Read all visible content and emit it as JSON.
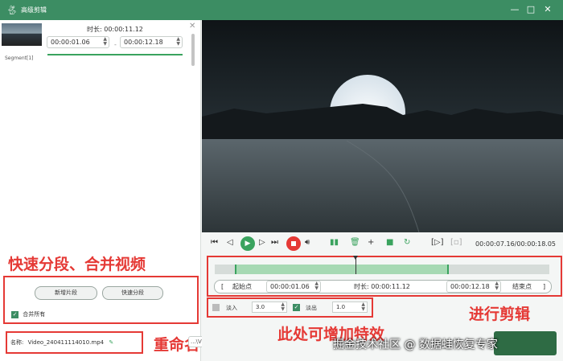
{
  "window": {
    "title": "高级剪辑",
    "logo_icon": "rabbit-logo-icon",
    "minimize": "—",
    "maximize": "□",
    "close": "✕"
  },
  "segment": {
    "label": "Segment[1]",
    "duration_label": "时长: 00:00:11.12",
    "start": "00:00:01.06",
    "end": "00:00:12.18",
    "dash": "-",
    "close": "✕",
    "progress": 1.0
  },
  "left_actions": {
    "new_segment": "新增片段",
    "quick_split": "快速分段",
    "merge_all": "合并所有",
    "merge_checked": true
  },
  "name_field": {
    "label": "名称:",
    "value": "Video_240411114010.mp4"
  },
  "output_field": {
    "value": "...\\Video"
  },
  "annotations": {
    "quick_split": "快速分段、合并视频",
    "rename": "重命名",
    "edit": "进行剪辑",
    "effects": "此处可增加特效"
  },
  "player": {
    "timecode": "00:00:07.16/00:00:18.05",
    "selection_start": 0.06,
    "selection_end": 0.7,
    "playhead": 0.42
  },
  "trim": {
    "start_btn": "起始点",
    "start_value": "00:00:01.06",
    "duration": "时长: 00:00:11.12",
    "end_value": "00:00:12.18",
    "end_btn": "结束点",
    "left_bracket": "[",
    "right_bracket": "]"
  },
  "fades": {
    "fade_in_label": "淡入",
    "fade_in_value": "3.0",
    "fade_in_checked": false,
    "fade_out_label": "淡出",
    "fade_out_value": "1.0",
    "fade_out_checked": true
  },
  "watermark": "掘金技术社区 @ 数据蛙恢复专家",
  "colors": {
    "accent": "#3c8d63",
    "annotation": "#e53935",
    "play": "#3aa35e",
    "stop": "#e53935"
  }
}
